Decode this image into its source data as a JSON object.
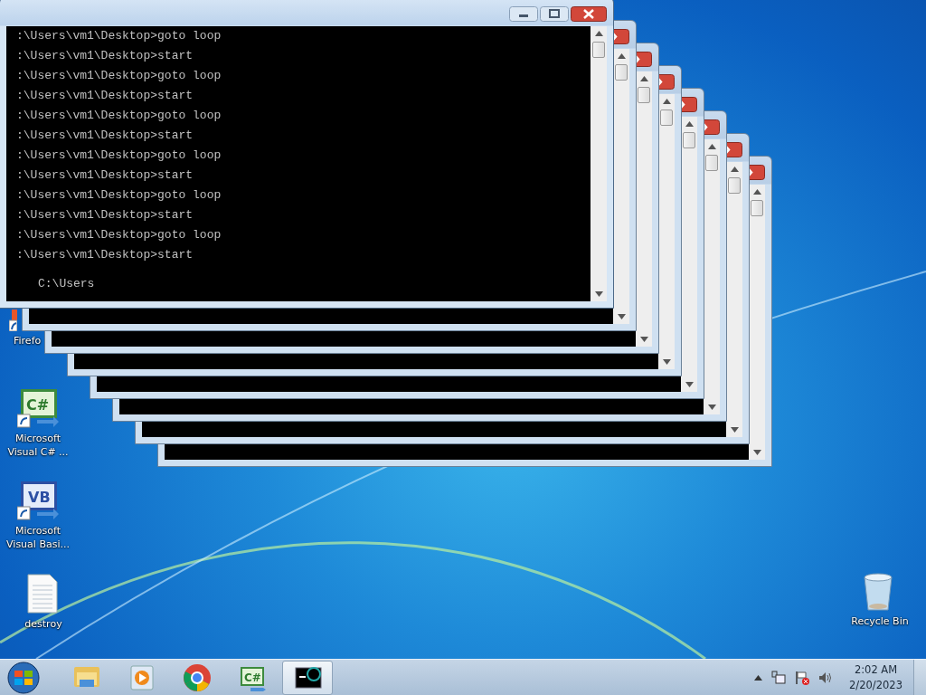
{
  "console_windows": [
    {
      "kind": "foreground",
      "lines": [
        ":\\Users\\vm1\\Desktop>goto loop",
        ":\\Users\\vm1\\Desktop>start",
        ":\\Users\\vm1\\Desktop>goto loop",
        ":\\Users\\vm1\\Desktop>start",
        ":\\Users\\vm1\\Desktop>goto loop",
        ":\\Users\\vm1\\Desktop>start",
        ":\\Users\\vm1\\Desktop>goto loop",
        ":\\Users\\vm1\\Desktop>start",
        ":\\Users\\vm1\\Desktop>goto loop",
        ":\\Users\\vm1\\Desktop>start",
        ":\\Users\\vm1\\Desktop>goto loop",
        ":\\Users\\vm1\\Desktop>start"
      ],
      "prompt": "C:\\Users"
    },
    {
      "kind": "background"
    },
    {
      "kind": "background"
    },
    {
      "kind": "background"
    },
    {
      "kind": "background"
    },
    {
      "kind": "background"
    },
    {
      "kind": "background"
    },
    {
      "kind": "background"
    }
  ],
  "desktop_icons": [
    {
      "kind": "firefox",
      "label": "Firefo"
    },
    {
      "kind": "csharp",
      "glyph": "C#",
      "label": "Microsoft Visual C# ..."
    },
    {
      "kind": "vb",
      "glyph": "VB",
      "label": "Microsoft Visual Basi..."
    },
    {
      "kind": "document",
      "label": "destroy"
    },
    {
      "kind": "recycle",
      "label": "Recycle Bin"
    }
  ],
  "taskbar": {
    "apps": [
      {
        "kind": "explorer",
        "active": false
      },
      {
        "kind": "media",
        "active": false
      },
      {
        "kind": "chrome",
        "active": false
      },
      {
        "kind": "csharp",
        "glyph": "C#",
        "active": false
      },
      {
        "kind": "console",
        "active": true
      }
    ],
    "time": "2:02 AM",
    "date": "2/20/2023"
  }
}
